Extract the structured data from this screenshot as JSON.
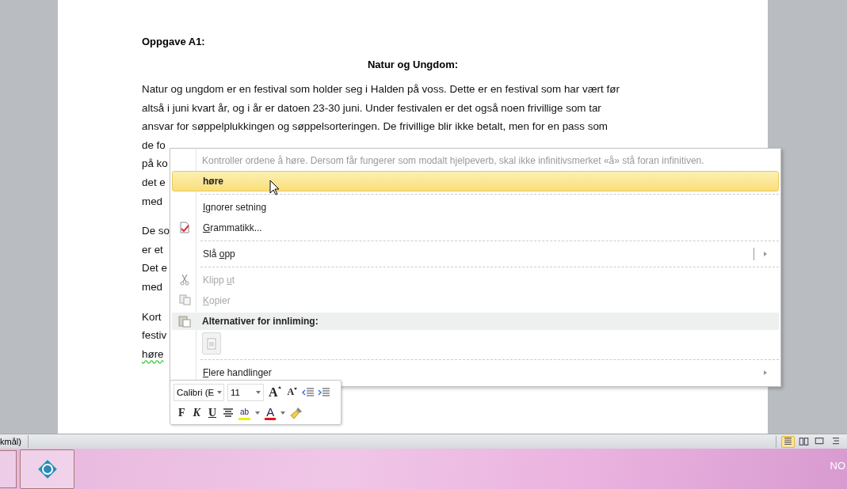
{
  "document": {
    "heading": "Oppgave A1:",
    "title": "Natur og Ungdom:",
    "paragraphs": [
      {
        "lines": [
          {
            "text": "Natur og ungdom er en festival som holder seg i Halden på voss. Dette er en festival som har vært før",
            "flagged": false
          },
          {
            "text": "altså i juni kvart år, og i år er datoen 23-30  juni. Under festivalen er det også noen frivillige  som tar",
            "flagged": false
          },
          {
            "text": "ansvar for søppelplukkingen og søppelsorteringen. De frivillige blir ikke betalt, men for en pass som",
            "flagged": false
          },
          {
            "text": "de fo",
            "flagged": false
          },
          {
            "text": "på ko",
            "flagged": false
          },
          {
            "text": "det e",
            "flagged": false
          },
          {
            "text": "med",
            "flagged": false
          }
        ]
      },
      {
        "lines": [
          {
            "text": "De so",
            "flagged": false
          },
          {
            "text": "er et",
            "flagged": false
          },
          {
            "text": "Det e",
            "flagged": false
          },
          {
            "text": "med",
            "flagged": false
          }
        ]
      },
      {
        "lines": [
          {
            "text": "Kort",
            "flagged": false
          },
          {
            "text": "festiv",
            "flagged": false
          },
          {
            "text": "høre",
            "flagged": true
          }
        ]
      }
    ]
  },
  "context_menu": {
    "hint": "Kontroller ordene å høre. Dersom får fungerer som modalt hjelpeverb, skal ikke infinitivsmerket «å» stå foran infinitiven.",
    "items": [
      {
        "kind": "suggestion",
        "label": "høre",
        "selected": true
      },
      {
        "kind": "separator"
      },
      {
        "kind": "command",
        "key": "I",
        "post": "gnorer setning",
        "disabled": false,
        "submenu": false
      },
      {
        "kind": "command",
        "key": "G",
        "post": "rammatikk...",
        "disabled": false,
        "submenu": false
      },
      {
        "kind": "separator"
      },
      {
        "kind": "command",
        "pre": "Slå ",
        "key": "o",
        "post": "pp",
        "disabled": false,
        "submenu": true,
        "split": true
      },
      {
        "kind": "separator"
      },
      {
        "kind": "command",
        "pre": "Klipp ",
        "key": "u",
        "post": "t",
        "disabled": true,
        "submenu": false
      },
      {
        "kind": "command",
        "key": "K",
        "post": "opier",
        "disabled": true,
        "submenu": false
      },
      {
        "kind": "header",
        "label": "Alternativer for innliming:"
      },
      {
        "kind": "paste-options"
      },
      {
        "kind": "separator"
      },
      {
        "kind": "command",
        "key": "F",
        "post": "lere handlinger",
        "disabled": false,
        "submenu": true
      }
    ]
  },
  "mini_toolbar": {
    "font": "Calibri (E",
    "size": "11",
    "font_tools": [
      {
        "kind": "grow",
        "label": "A"
      },
      {
        "kind": "shrink",
        "label": "A"
      },
      {
        "kind": "outdent"
      },
      {
        "kind": "indent"
      }
    ],
    "format_tools": [
      {
        "kind": "bold",
        "label": "F"
      },
      {
        "kind": "italic",
        "label": "K"
      },
      {
        "kind": "underline",
        "label": "U"
      },
      {
        "kind": "center"
      },
      {
        "kind": "highlight",
        "label": "ab"
      },
      {
        "kind": "font-color",
        "label": "A"
      },
      {
        "kind": "painter"
      }
    ]
  },
  "status_bar": {
    "language": "kmål)",
    "views": [
      {
        "kind": "print",
        "selected": true
      },
      {
        "kind": "reading",
        "selected": false
      },
      {
        "kind": "web",
        "selected": false
      },
      {
        "kind": "outline",
        "selected": false
      }
    ]
  },
  "taskbar": {
    "tray_text": "NO"
  }
}
